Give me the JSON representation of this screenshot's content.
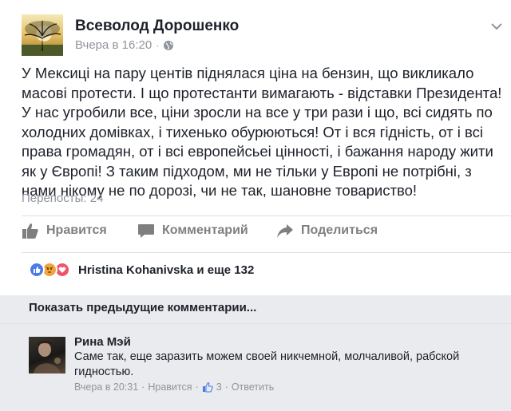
{
  "post": {
    "author": "Всеволод Дорошенко",
    "time": "Вчера в 16:20",
    "separator": "·",
    "text": "У Мексиці на пару центів піднялася ціна на бензин, що викликало масові протести. І що протестанти вимагають - відставки Президента! У нас угробили все, ціни зросли на все у три рази і що, всі сидять по холодних домівках, і тихенько обурюються! От і вся гідність, от і всі права громадян, от і всі европейсьеі цінності, і бажання народу жити як у Європі! З таким підходом, ми  не тільки у Европі не потрібні, з нами нікому не по дорозі, чи не так, шановне товариство!",
    "reposts": "Перепосты: 24"
  },
  "actions": {
    "like_label": "Нравится",
    "comment_label": "Комментарий",
    "share_label": "Поделиться"
  },
  "reactions": {
    "text": "Hristina Kohanivska и еще 132",
    "colors": {
      "like": "#4a7be8",
      "angry": "#f0a43a",
      "love": "#f25268"
    }
  },
  "comments": {
    "prev_label": "Показать предыдущие комментарии...",
    "items": [
      {
        "name": "Рина Мэй",
        "text": "Саме так, еще заразить можем своей никчемной, молчаливой, рабской гидностью.",
        "time": "Вчера в 20:31",
        "sep1": "·",
        "like_label": "Нравится",
        "sep2": "·",
        "likes": "3",
        "sep3": "·",
        "reply_label": "Ответить"
      }
    ]
  },
  "colors": {
    "muted": "#90949c",
    "text": "#1d2129",
    "background": "#e9ebee",
    "like_blue": "#4a7be8"
  }
}
